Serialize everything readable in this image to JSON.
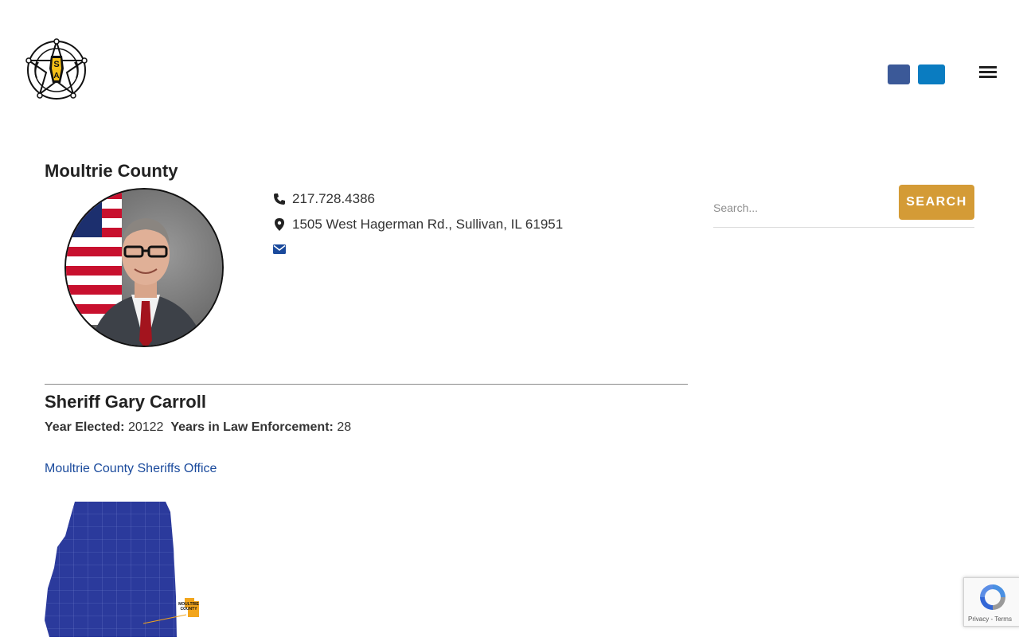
{
  "header": {
    "logo_text": "ILLINOIS SHERIFFS' ASSOCIATION",
    "logo_letters": "ISA",
    "social": [
      {
        "name": "facebook-icon",
        "color": "#3b5998"
      },
      {
        "name": "linkedin-icon",
        "color": "#0a7cc1"
      }
    ],
    "menu_icon": "hamburger-menu-icon"
  },
  "county": {
    "title": "Moultrie County",
    "phone": "217.728.4386",
    "address": "1505 West Hagerman Rd., Sullivan, IL 61951",
    "email_icon": "envelope-icon"
  },
  "sheriff": {
    "name": "Sheriff Gary Carroll",
    "year_elected_label": "Year Elected:",
    "year_elected": "20122",
    "years_label": "Years in Law Enforcement:",
    "years": "28",
    "office_link": "Moultrie County Sheriffs Office"
  },
  "map": {
    "callout_label_line1": "MOULTRIE",
    "callout_label_line2": "COUNTY",
    "state_color": "#2b3a9c",
    "highlight_color": "#f2a51c"
  },
  "search": {
    "placeholder": "Search...",
    "button_label": "SEARCH"
  },
  "recaptcha": {
    "text": "Privacy - Terms"
  },
  "colors": {
    "accent": "#d49b36",
    "link": "#1a4a9c"
  }
}
